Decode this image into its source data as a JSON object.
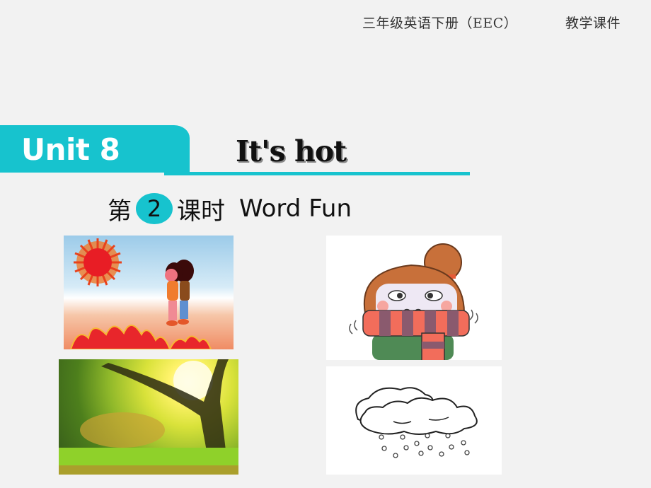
{
  "header": {
    "course": "三年级英语下册（EEC）",
    "type": "教学课件"
  },
  "title": {
    "unit": "Unit 8",
    "lesson_title": "It's hot"
  },
  "lesson": {
    "prefix": "第",
    "number": "2",
    "suffix": "课时",
    "name": "Word Fun"
  },
  "colors": {
    "accent": "#17c3ce",
    "background": "#f2f2f2"
  },
  "images": [
    {
      "name": "hot-weather-picture",
      "depicts": "sun, two children walking over flames"
    },
    {
      "name": "cold-weather-picture",
      "depicts": "girl shivering wrapped in striped scarf"
    },
    {
      "name": "sunny-weather-picture",
      "depicts": "sunlight through trees over grass"
    },
    {
      "name": "rainy-weather-picture",
      "depicts": "cloud with raindrops line drawing"
    }
  ]
}
